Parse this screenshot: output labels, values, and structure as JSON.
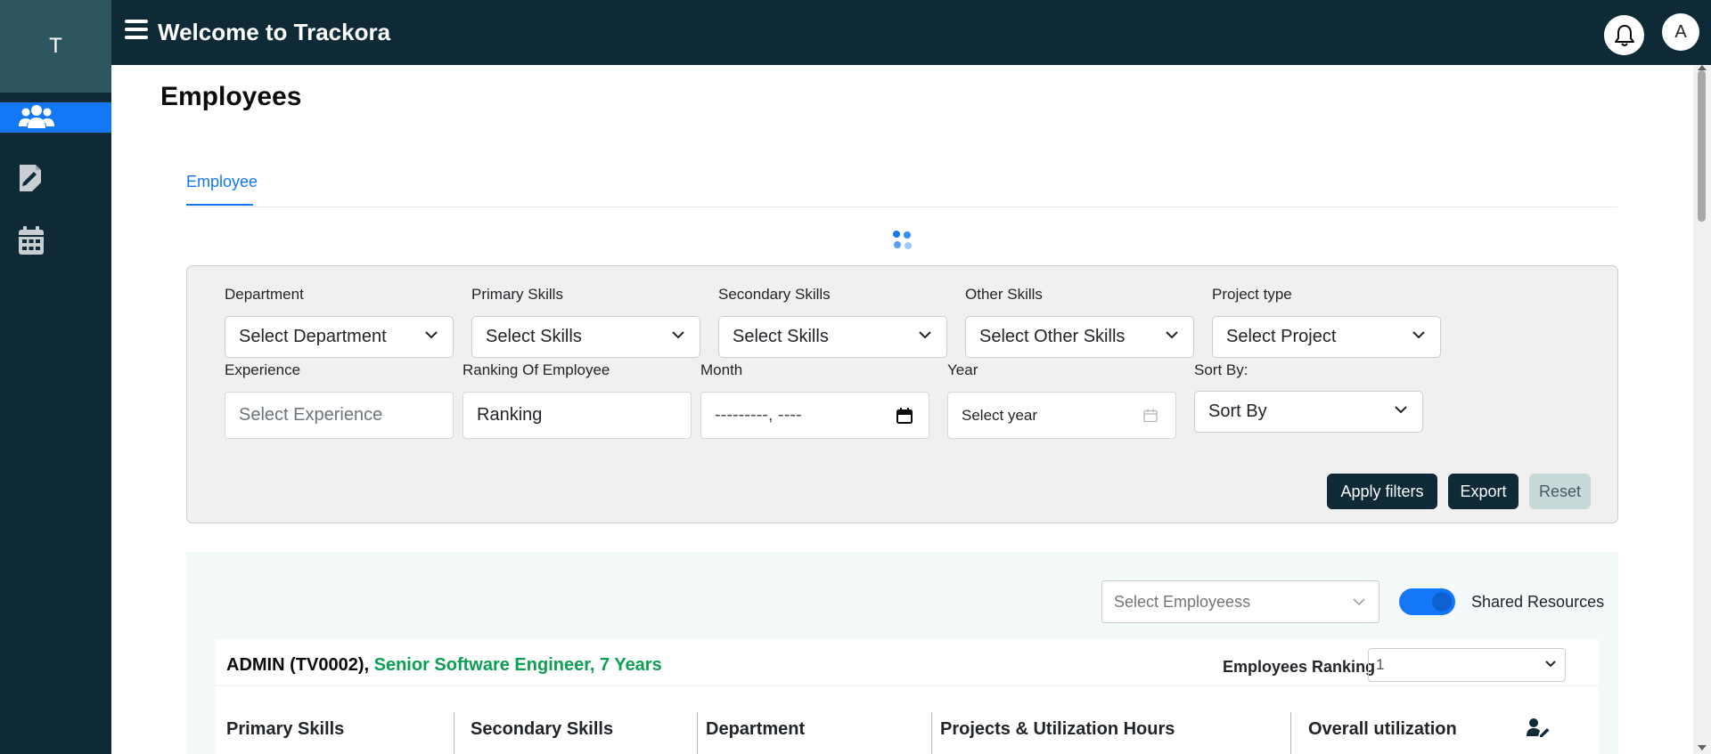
{
  "sidebar": {
    "logo_letter": "T",
    "items": [
      {
        "icon": "users-icon",
        "active": true
      },
      {
        "icon": "document-icon",
        "active": false
      },
      {
        "icon": "calendar-icon",
        "active": false
      }
    ]
  },
  "header": {
    "title": "Welcome to Trackora",
    "avatar_letter": "A"
  },
  "page": {
    "title": "Employees",
    "tabs": [
      {
        "label": "Employee",
        "active": true
      }
    ]
  },
  "filters": {
    "department": {
      "label": "Department",
      "value": "Select Department"
    },
    "primary_skills": {
      "label": "Primary Skills",
      "value": "Select Skills"
    },
    "secondary_skills": {
      "label": "Secondary Skills",
      "value": "Select Skills"
    },
    "other_skills": {
      "label": "Other Skills",
      "value": "Select Other Skills"
    },
    "project_type": {
      "label": "Project type",
      "value": "Select Project"
    },
    "experience": {
      "label": "Experience",
      "placeholder": "Select Experience"
    },
    "ranking": {
      "label": "Ranking Of Employee",
      "value": "Ranking"
    },
    "month": {
      "label": "Month",
      "value": "---------, ----"
    },
    "year": {
      "label": "Year",
      "placeholder": "Select year"
    },
    "sort_by": {
      "label": "Sort By:",
      "value": "Sort By"
    },
    "buttons": {
      "apply": "Apply filters",
      "export": "Export",
      "reset": "Reset"
    }
  },
  "employees_panel": {
    "select_placeholder": "Select Employeess",
    "shared_resources_label": "Shared Resources",
    "shared_resources_on": true,
    "card": {
      "name": "ADMIN (TV0002)",
      "separator": ", ",
      "role": "Senior Software Engineer, 7 Years",
      "ranking_label": "Employees Ranking",
      "ranking_value": "1",
      "columns": [
        "Primary Skills",
        "Secondary Skills",
        "Department",
        "Projects & Utilization Hours",
        "Overall utilization"
      ]
    }
  },
  "colors": {
    "sidebar_bg": "#0e2a36",
    "accent": "#1477f8",
    "role_green": "#0c9e52"
  }
}
